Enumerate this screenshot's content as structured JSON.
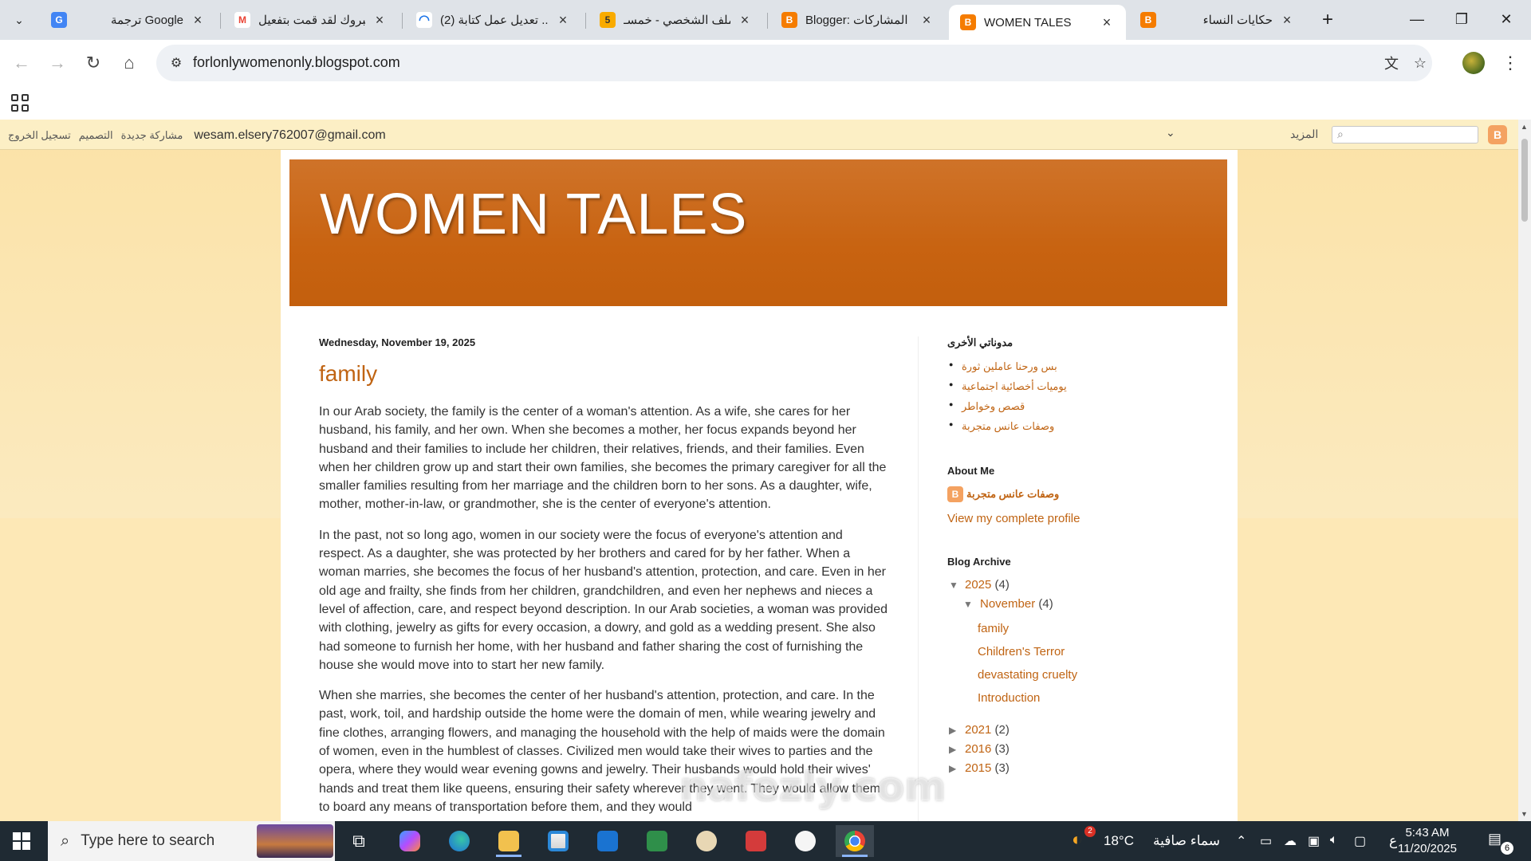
{
  "browser": {
    "tabs": [
      {
        "title": "ترجمة Google",
        "favicon": "google-translate-icon",
        "color": "#4285f4"
      },
      {
        "title": "مبروك لقد قمت بتفعيل",
        "favicon": "gmail-icon",
        "color": "#ea4335"
      },
      {
        "title": "(2) تعديل عمل كتابة ...",
        "favicon": "loading-icon",
        "color": "#1a73e8"
      },
      {
        "title": "الملف الشخصي - خمسـ",
        "favicon": "five-icon",
        "color": "#f9ab00"
      },
      {
        "title": "Blogger: المشاركات",
        "favicon": "blogger-icon",
        "color": "#f57c00"
      },
      {
        "title": "WOMEN TALES",
        "favicon": "blogger-icon",
        "color": "#f57c00"
      },
      {
        "title": "حكايات النساء",
        "favicon": "blogger-icon",
        "color": "#f57c00"
      }
    ],
    "active_tab": 5,
    "url": "forlonlywomenonly.blogspot.com"
  },
  "navbar": {
    "links": [
      "تسجيل الخروج",
      "التصميم",
      "مشاركة جديدة"
    ],
    "email": "wesam.elsery762007@gmail.com",
    "more": "المزيد"
  },
  "blog": {
    "title": "WOMEN TALES",
    "date_header": "Wednesday, November 19, 2025",
    "post_title": "family",
    "paragraphs": [
      "In our Arab society, the family is the center of a woman's attention. As a wife, she cares for her husband, his family, and her own. When she becomes a mother, her focus expands beyond her husband and their families to include her children, their relatives, friends, and their families. Even when her children grow up and start their own families, she becomes the primary caregiver for all the smaller families resulting from her marriage and the children born to her sons. As a daughter, wife, mother, mother-in-law, or grandmother, she is the center of everyone's attention.",
      "In the past, not so long ago, women in our society were the focus of everyone's attention and respect. As a daughter, she was protected by her brothers and cared for by her father. When a woman marries, she becomes the focus of her husband's attention, protection, and care. Even in her old age and frailty, she finds from her children, grandchildren, and even her nephews and nieces a level of affection, care, and respect beyond description. In our Arab societies, a woman was provided with clothing, jewelry as gifts for every occasion, a dowry, and gold as a wedding present. She also had someone to furnish her home, with her husband and father sharing the cost of furnishing the house she would move into to start her new family.",
      "When she marries, she becomes the center of her husband's attention, protection, and care. In the past, work, toil, and hardship outside the home were the domain of men, while wearing jewelry and fine clothes, arranging flowers, and managing the household with the help of maids were the domain of women, even in the humblest of classes. Civilized men would take their wives to parties and the opera, where they would wear evening gowns and jewelry. Their husbands would hold their wives' hands and treat them like queens, ensuring their safety wherever they went. They would allow them to board any means of transportation before them, and they would"
    ]
  },
  "sidebar": {
    "other_blogs_title": "مدوناتي الأخرى",
    "other_blogs": [
      "بس ورحنا عاملين ثورة",
      "يوميات أخصائية اجتماعية",
      "قصص وخواطر",
      "وصفات عانس متجربة"
    ],
    "about_title": "About Me",
    "profile_name": "وصفات عانس متجربة",
    "profile_link": "View my complete profile",
    "archive_title": "Blog Archive",
    "archive": [
      {
        "year": "2025",
        "count": "(4)",
        "expanded": true,
        "month": {
          "name": "November",
          "count": "(4)"
        },
        "posts": [
          "family",
          "Children's Terror",
          "devastating cruelty",
          "Introduction"
        ]
      },
      {
        "year": "2021",
        "count": "(2)",
        "expanded": false
      },
      {
        "year": "2016",
        "count": "(3)",
        "expanded": false
      },
      {
        "year": "2015",
        "count": "(3)",
        "expanded": false
      }
    ]
  },
  "watermark": "nafezly.com",
  "taskbar": {
    "search_placeholder": "Type here to search",
    "weather": "18°C",
    "weather_desc": "سماء صافية",
    "weather_badge": "2",
    "lang": "ع",
    "time": "5:43 AM",
    "date": "11/20/2025",
    "notification_count": "6"
  }
}
